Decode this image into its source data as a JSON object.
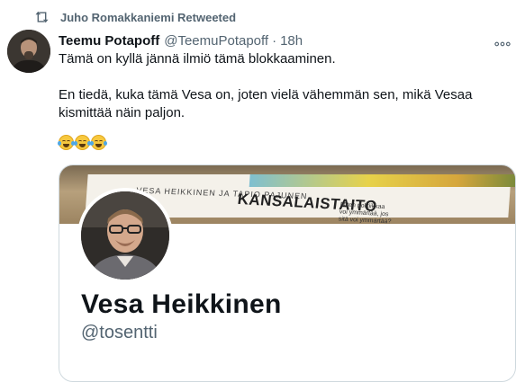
{
  "retweet": {
    "label": "Juho Romakkaniemi Retweeted"
  },
  "tweet": {
    "author_name": "Teemu Potapoff",
    "author_handle": "@TeemuPotapoff",
    "separator": "·",
    "time": "18h",
    "text_p1": "Tämä on kyllä jännä ilmiö tämä blokkaaminen.",
    "text_p2": "En tiedä, kuka tämä Vesa on, joten vielä vähemmän sen, mikä Vesaa kismittää näin paljon.",
    "emoji_icon": "face-with-tears-of-joy-icon",
    "emoji_count": 3
  },
  "card": {
    "book_authors": "VESA HEIKKINEN JA TAPIO PAJUNEN",
    "book_title": "KANSALAISTAITO",
    "book_subtitle": "Miten politiikkaa voi ymmärtää, jos sitä voi ymmärtää?",
    "profile_name": "Vesa Heikkinen",
    "profile_handle": "@tosentti"
  },
  "colors": {
    "text": "#0f1419",
    "secondary": "#536471",
    "border": "#cfd9de"
  }
}
